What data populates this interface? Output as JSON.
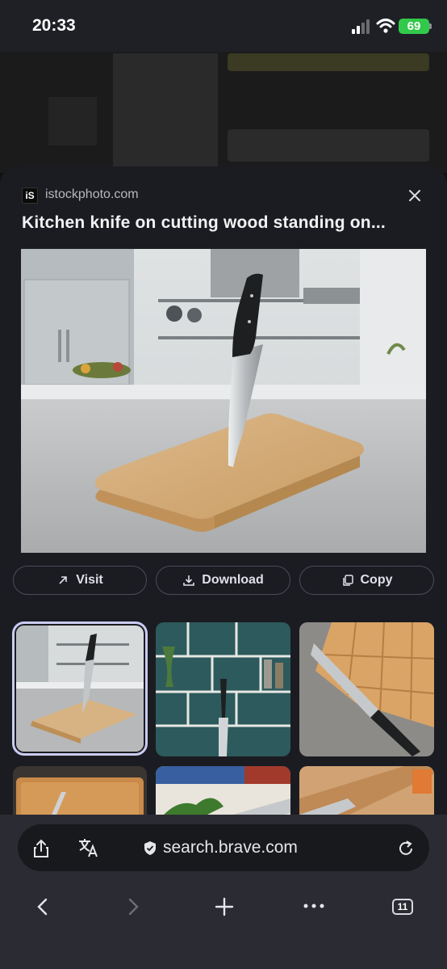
{
  "status_bar": {
    "time": "20:33",
    "battery": "69"
  },
  "sheet": {
    "favicon_text": "iS",
    "domain": "istockphoto.com",
    "title": "Kitchen knife on cutting wood standing on...",
    "actions": {
      "visit": "Visit",
      "download": "Download",
      "copy": "Copy"
    }
  },
  "browser": {
    "url": "search.brave.com",
    "tab_count": "11"
  },
  "icons": [
    "close-icon",
    "arrow-up-right-icon",
    "download-icon",
    "copy-icon",
    "share-icon",
    "translate-icon",
    "shield-icon",
    "reload-icon",
    "back-icon",
    "forward-icon",
    "plus-icon",
    "more-icon",
    "tabs-icon"
  ],
  "colors": {
    "sheet_bg": "#1b1c21",
    "selected_outline": "#c9ccf4",
    "battery": "#31c94a",
    "button_border": "#4a4c5c"
  }
}
